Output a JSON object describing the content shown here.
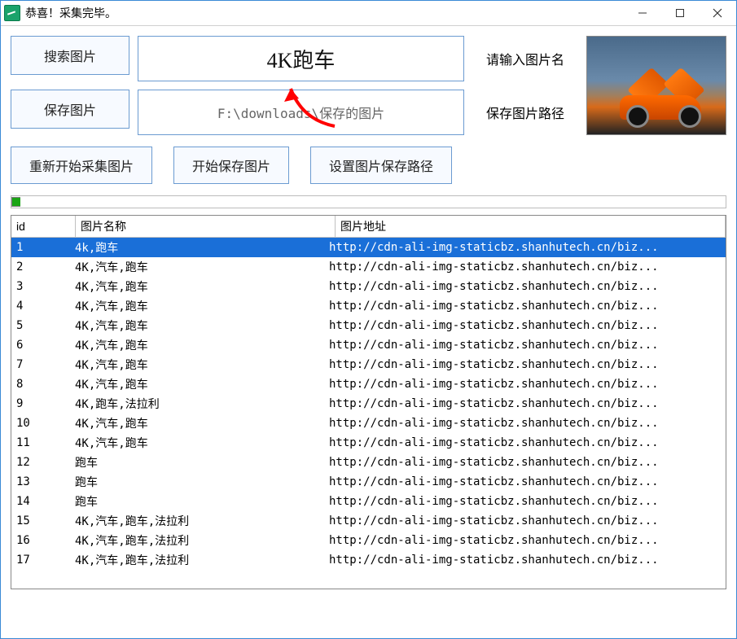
{
  "window": {
    "title": "恭喜！采集完毕。"
  },
  "search": {
    "button": "搜索图片",
    "value": "4K跑车",
    "placeholder_label": "请输入图片名"
  },
  "save": {
    "button": "保存图片",
    "path": "F:\\downloads\\保存的图片",
    "path_label": "保存图片路径"
  },
  "actions": {
    "restart": "重新开始采集图片",
    "start_save": "开始保存图片",
    "set_path": "设置图片保存路径"
  },
  "grid": {
    "headers": {
      "id": "id",
      "name": "图片名称",
      "url": "图片地址"
    },
    "rows": [
      {
        "id": "1",
        "name": "4k,跑车",
        "url": "http://cdn-ali-img-staticbz.shanhutech.cn/biz...",
        "selected": true
      },
      {
        "id": "2",
        "name": "4K,汽车,跑车",
        "url": "http://cdn-ali-img-staticbz.shanhutech.cn/biz..."
      },
      {
        "id": "3",
        "name": "4K,汽车,跑车",
        "url": "http://cdn-ali-img-staticbz.shanhutech.cn/biz..."
      },
      {
        "id": "4",
        "name": "4K,汽车,跑车",
        "url": "http://cdn-ali-img-staticbz.shanhutech.cn/biz..."
      },
      {
        "id": "5",
        "name": "4K,汽车,跑车",
        "url": "http://cdn-ali-img-staticbz.shanhutech.cn/biz..."
      },
      {
        "id": "6",
        "name": "4K,汽车,跑车",
        "url": "http://cdn-ali-img-staticbz.shanhutech.cn/biz..."
      },
      {
        "id": "7",
        "name": "4K,汽车,跑车",
        "url": "http://cdn-ali-img-staticbz.shanhutech.cn/biz..."
      },
      {
        "id": "8",
        "name": "4K,汽车,跑车",
        "url": "http://cdn-ali-img-staticbz.shanhutech.cn/biz..."
      },
      {
        "id": "9",
        "name": "4K,跑车,法拉利",
        "url": "http://cdn-ali-img-staticbz.shanhutech.cn/biz..."
      },
      {
        "id": "10",
        "name": "4K,汽车,跑车",
        "url": "http://cdn-ali-img-staticbz.shanhutech.cn/biz..."
      },
      {
        "id": "11",
        "name": "4K,汽车,跑车",
        "url": "http://cdn-ali-img-staticbz.shanhutech.cn/biz..."
      },
      {
        "id": "12",
        "name": "跑车",
        "url": "http://cdn-ali-img-staticbz.shanhutech.cn/biz..."
      },
      {
        "id": "13",
        "name": "跑车",
        "url": "http://cdn-ali-img-staticbz.shanhutech.cn/biz..."
      },
      {
        "id": "14",
        "name": "跑车",
        "url": "http://cdn-ali-img-staticbz.shanhutech.cn/biz..."
      },
      {
        "id": "15",
        "name": "4K,汽车,跑车,法拉利",
        "url": "http://cdn-ali-img-staticbz.shanhutech.cn/biz..."
      },
      {
        "id": "16",
        "name": "4K,汽车,跑车,法拉利",
        "url": "http://cdn-ali-img-staticbz.shanhutech.cn/biz..."
      },
      {
        "id": "17",
        "name": "4K,汽车,跑车,法拉利",
        "url": "http://cdn-ali-img-staticbz.shanhutech.cn/biz..."
      }
    ]
  }
}
